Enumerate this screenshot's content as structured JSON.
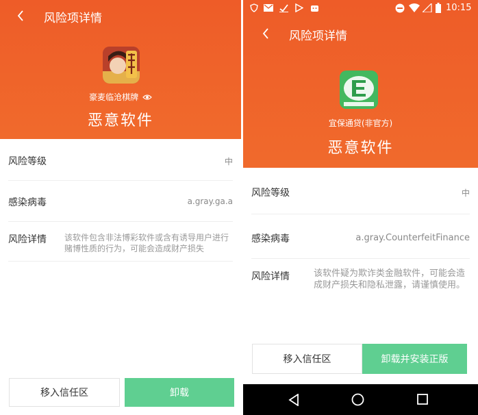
{
  "left": {
    "title": "风险项详情",
    "app_name": "豪麦临沧棋牌",
    "verdict": "恶意软件",
    "rows": [
      {
        "label": "风险等级",
        "value": "中"
      },
      {
        "label": "感染病毒",
        "value": "a.gray.ga.a"
      },
      {
        "label": "风险详情",
        "value": "该软件包含非法博彩软件或含有诱导用户进行赌博性质的行为，可能会造成财产损失"
      }
    ],
    "btn_trust": "移入信任区",
    "btn_uninstall": "卸载"
  },
  "right": {
    "status_time": "10:15",
    "title": "风险项详情",
    "app_name": "宜保通贷(非官方)",
    "verdict": "恶意软件",
    "rows": [
      {
        "label": "风险等级",
        "value": "中"
      },
      {
        "label": "感染病毒",
        "value": "a.gray.CounterfeitFinance"
      },
      {
        "label": "风险详情",
        "value": "该软件疑为欺诈类金融软件，可能会造成财产损失和隐私泄露，请谨慎使用。"
      }
    ],
    "btn_trust": "移入信任区",
    "btn_uninstall": "卸载并安装正版"
  },
  "colors": {
    "header": "#ee5c28",
    "accent_green": "#5fcf91"
  },
  "icons": [
    "back-arrow-icon",
    "eye-icon",
    "shield-status-icon",
    "mail-icon",
    "download-icon",
    "play-icon",
    "android-icon",
    "dnd-icon",
    "wifi-icon",
    "signal-icon",
    "battery-icon",
    "nav-back-icon",
    "nav-home-icon",
    "nav-recents-icon"
  ]
}
